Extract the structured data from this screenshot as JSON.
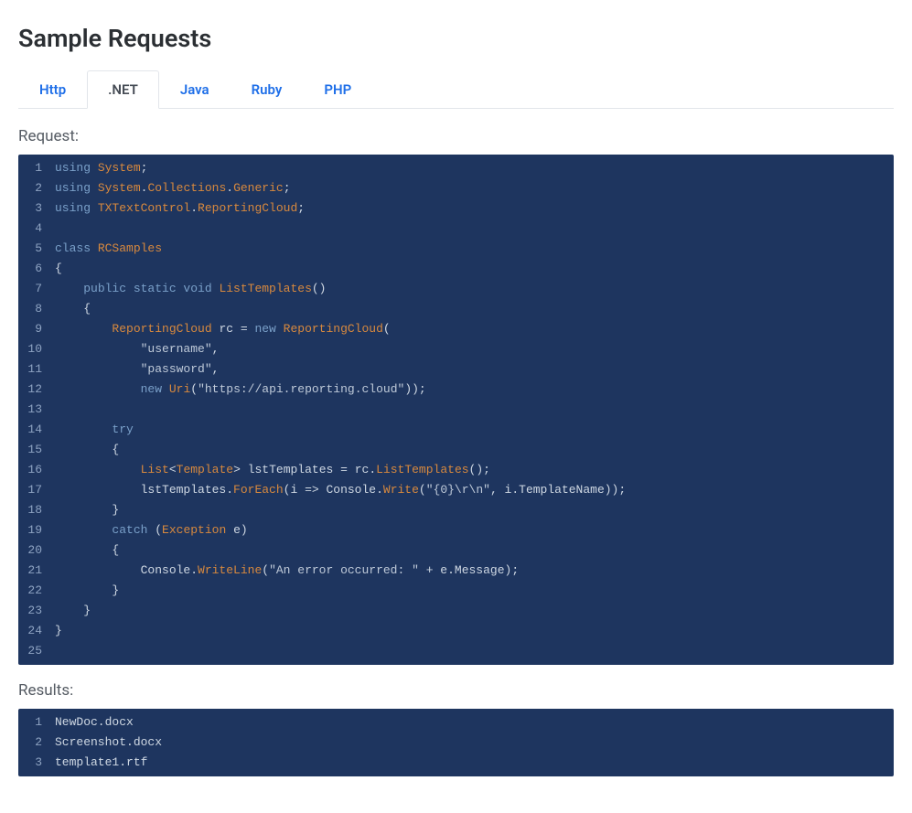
{
  "title": "Sample Requests",
  "tabs": [
    {
      "label": "Http",
      "active": false
    },
    {
      "label": ".NET",
      "active": true
    },
    {
      "label": "Java",
      "active": false
    },
    {
      "label": "Ruby",
      "active": false
    },
    {
      "label": "PHP",
      "active": false
    }
  ],
  "request_label": "Request:",
  "results_label": "Results:",
  "code_lines": [
    {
      "n": 1,
      "tokens": [
        [
          "kw",
          "using "
        ],
        [
          "type",
          "System"
        ],
        [
          "punct",
          ";"
        ]
      ]
    },
    {
      "n": 2,
      "tokens": [
        [
          "kw",
          "using "
        ],
        [
          "type",
          "System"
        ],
        [
          "punct",
          "."
        ],
        [
          "type",
          "Collections"
        ],
        [
          "punct",
          "."
        ],
        [
          "type",
          "Generic"
        ],
        [
          "punct",
          ";"
        ]
      ]
    },
    {
      "n": 3,
      "tokens": [
        [
          "kw",
          "using "
        ],
        [
          "type",
          "TXTextControl"
        ],
        [
          "punct",
          "."
        ],
        [
          "type",
          "ReportingCloud"
        ],
        [
          "punct",
          ";"
        ]
      ]
    },
    {
      "n": 4,
      "tokens": [
        [
          "",
          ""
        ]
      ]
    },
    {
      "n": 5,
      "tokens": [
        [
          "kw",
          "class "
        ],
        [
          "type",
          "RCSamples"
        ]
      ]
    },
    {
      "n": 6,
      "tokens": [
        [
          "punct",
          "{"
        ]
      ]
    },
    {
      "n": 7,
      "tokens": [
        [
          "",
          "    "
        ],
        [
          "kw",
          "public static void "
        ],
        [
          "fn",
          "ListTemplates"
        ],
        [
          "punct",
          "()"
        ]
      ]
    },
    {
      "n": 8,
      "tokens": [
        [
          "",
          "    "
        ],
        [
          "punct",
          "{"
        ]
      ]
    },
    {
      "n": 9,
      "tokens": [
        [
          "",
          "        "
        ],
        [
          "type",
          "ReportingCloud"
        ],
        [
          "",
          " rc = "
        ],
        [
          "kw",
          "new "
        ],
        [
          "type",
          "ReportingCloud"
        ],
        [
          "punct",
          "("
        ]
      ]
    },
    {
      "n": 10,
      "tokens": [
        [
          "",
          "            "
        ],
        [
          "str",
          "\"username\""
        ],
        [
          "punct",
          ","
        ]
      ]
    },
    {
      "n": 11,
      "tokens": [
        [
          "",
          "            "
        ],
        [
          "str",
          "\"password\""
        ],
        [
          "punct",
          ","
        ]
      ]
    },
    {
      "n": 12,
      "tokens": [
        [
          "",
          "            "
        ],
        [
          "kw",
          "new "
        ],
        [
          "fn",
          "Uri"
        ],
        [
          "punct",
          "("
        ],
        [
          "str",
          "\"https://api.reporting.cloud\""
        ],
        [
          "punct",
          "));"
        ]
      ]
    },
    {
      "n": 13,
      "tokens": [
        [
          "",
          ""
        ]
      ]
    },
    {
      "n": 14,
      "tokens": [
        [
          "",
          "        "
        ],
        [
          "kw",
          "try"
        ]
      ]
    },
    {
      "n": 15,
      "tokens": [
        [
          "",
          "        "
        ],
        [
          "punct",
          "{"
        ]
      ]
    },
    {
      "n": 16,
      "tokens": [
        [
          "",
          "            "
        ],
        [
          "type",
          "List"
        ],
        [
          "punct",
          "<"
        ],
        [
          "type",
          "Template"
        ],
        [
          "punct",
          ">"
        ],
        [
          "",
          " lstTemplates = rc."
        ],
        [
          "fn",
          "ListTemplates"
        ],
        [
          "punct",
          "();"
        ]
      ]
    },
    {
      "n": 17,
      "tokens": [
        [
          "",
          "            lstTemplates."
        ],
        [
          "fn",
          "ForEach"
        ],
        [
          "punct",
          "("
        ],
        [
          "",
          "i => Console."
        ],
        [
          "fn",
          "Write"
        ],
        [
          "punct",
          "("
        ],
        [
          "str",
          "\"{0}\\r\\n\""
        ],
        [
          "punct",
          ", i.TemplateName));"
        ]
      ]
    },
    {
      "n": 18,
      "tokens": [
        [
          "",
          "        "
        ],
        [
          "punct",
          "}"
        ]
      ]
    },
    {
      "n": 19,
      "tokens": [
        [
          "",
          "        "
        ],
        [
          "kw",
          "catch "
        ],
        [
          "punct",
          "("
        ],
        [
          "type",
          "Exception"
        ],
        [
          "",
          " e"
        ],
        [
          "punct",
          ")"
        ]
      ]
    },
    {
      "n": 20,
      "tokens": [
        [
          "",
          "        "
        ],
        [
          "punct",
          "{"
        ]
      ]
    },
    {
      "n": 21,
      "tokens": [
        [
          "",
          "            Console."
        ],
        [
          "fn",
          "WriteLine"
        ],
        [
          "punct",
          "("
        ],
        [
          "str",
          "\"An error occurred: \""
        ],
        [
          "",
          " + e.Message"
        ],
        [
          "punct",
          ");"
        ]
      ]
    },
    {
      "n": 22,
      "tokens": [
        [
          "",
          "        "
        ],
        [
          "punct",
          "}"
        ]
      ]
    },
    {
      "n": 23,
      "tokens": [
        [
          "",
          "    "
        ],
        [
          "punct",
          "}"
        ]
      ]
    },
    {
      "n": 24,
      "tokens": [
        [
          "punct",
          "}"
        ]
      ]
    },
    {
      "n": 25,
      "tokens": [
        [
          "",
          ""
        ]
      ]
    }
  ],
  "result_lines": [
    {
      "n": 1,
      "text": "NewDoc.docx"
    },
    {
      "n": 2,
      "text": "Screenshot.docx"
    },
    {
      "n": 3,
      "text": "template1.rtf"
    }
  ]
}
